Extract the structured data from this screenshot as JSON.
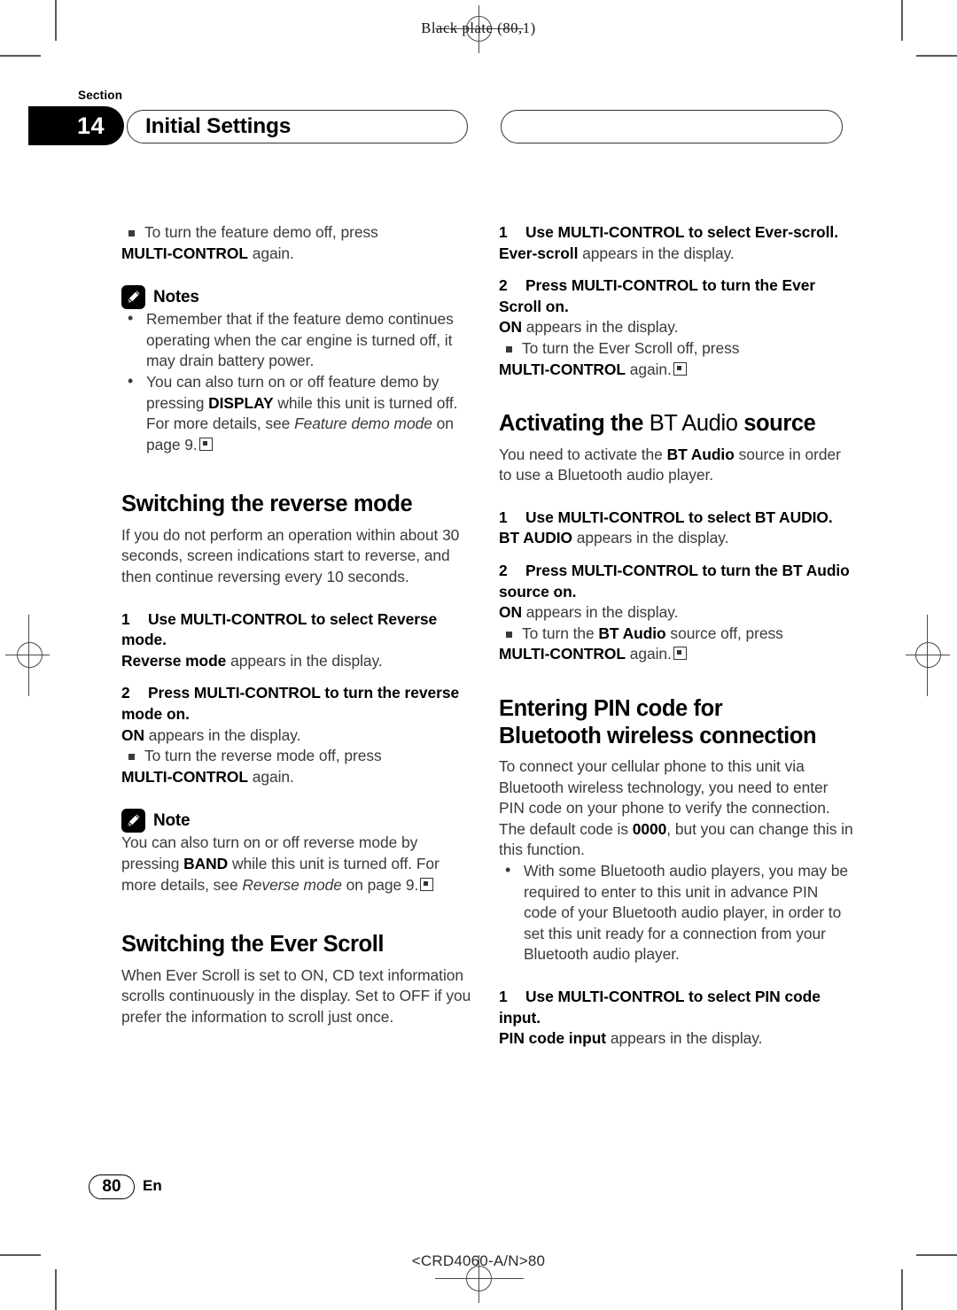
{
  "print_marks": {
    "plate_label": "Black plate (80,1)"
  },
  "header": {
    "section_word": "Section",
    "section_number": "14",
    "chapter_title": "Initial Settings"
  },
  "left_column": {
    "bullet_turn_demo_off": {
      "text_1": "To turn the feature demo off, press ",
      "bold_1": "MULTI-CONTROL",
      "text_2": " again."
    },
    "notes_label": "Notes",
    "note_items": [
      "Remember that if the feature demo continues operating when the car engine is turned off, it may drain battery power.",
      {
        "t1": "You can also turn on or off feature demo by pressing ",
        "b1": "DISPLAY",
        "t2": " while this unit is turned off. For more details, see ",
        "i1": "Feature demo mode",
        "t3": " on page 9."
      }
    ],
    "heading_reverse": "Switching the reverse mode",
    "intro_reverse": "If you do not perform an operation within about 30 seconds, screen indications start to reverse, and then continue reversing every 10 seconds.",
    "step1_num": "1",
    "step1_text": "Use MULTI-CONTROL to select Reverse mode.",
    "step1_result_bold": "Reverse mode",
    "step1_result_rest": " appears in the display.",
    "step2_num": "2",
    "step2_text": "Press MULTI-CONTROL to turn the reverse mode on.",
    "step2_result_bold": "ON",
    "step2_result_rest": " appears in the display.",
    "step2_bullet": {
      "text_1": "To turn the reverse mode off, press ",
      "bold_1": "MULTI-CONTROL",
      "text_2": " again."
    },
    "note_label": "Note",
    "note_body": {
      "t1": "You can also turn on or off reverse mode by pressing ",
      "b1": "BAND",
      "t2": " while this unit is turned off. For more details, see ",
      "i1": "Reverse mode",
      "t3": " on page 9."
    },
    "heading_ever_scroll": "Switching the Ever Scroll",
    "intro_ever_scroll": "When Ever Scroll is set to ON, CD text information scrolls continuously in the display. Set to OFF if you prefer the information to scroll just once."
  },
  "right_column": {
    "step1_num": "1",
    "step1_text": "Use MULTI-CONTROL to select Ever-scroll.",
    "step1_result_bold": "Ever-scroll",
    "step1_result_rest": " appears in the display.",
    "step2_num": "2",
    "step2_text": "Press MULTI-CONTROL to turn the Ever Scroll on.",
    "step2_result_bold": "ON",
    "step2_result_rest": " appears in the display.",
    "step2_bullet": {
      "text_1": "To turn the Ever Scroll off, press ",
      "bold_1": "MULTI-CONTROL",
      "text_2": " again."
    },
    "heading_bt_audio_a": "Activating the ",
    "heading_bt_audio_b": "BT Audio",
    "heading_bt_audio_c": " source",
    "intro_bt_audio": {
      "t1": "You need to activate the ",
      "b1": "BT Audio",
      "t2": " source in order to use a Bluetooth audio player."
    },
    "bt_step1_num": "1",
    "bt_step1_text": "Use MULTI-CONTROL to select BT AUDIO.",
    "bt_step1_result_bold": "BT AUDIO",
    "bt_step1_result_rest": " appears in the display.",
    "bt_step2_num": "2",
    "bt_step2_text": "Press MULTI-CONTROL to turn the BT Audio source on.",
    "bt_step2_result_bold": "ON",
    "bt_step2_result_rest": " appears in the display.",
    "bt_step2_bullet": {
      "text_1": "To turn the ",
      "bold_1": "BT Audio",
      "text_2": " source off, press ",
      "bold_2": "MULTI-CONTROL",
      "text_3": " again."
    },
    "heading_pin_line1": "Entering PIN code for",
    "heading_pin_line2": "Bluetooth wireless connection",
    "intro_pin": {
      "t1": "To connect your cellular phone to this unit via Bluetooth wireless technology, you need to enter PIN code on your phone to verify the connection. The default code is ",
      "b1": "0000",
      "t2": ", but you can change this in this function."
    },
    "pin_bullet": "With some Bluetooth audio players, you may be required to enter to this unit in advance PIN code of your Bluetooth audio player, in order to set this unit ready for a connection from your Bluetooth audio player.",
    "pin_step1_num": "1",
    "pin_step1_text": "Use MULTI-CONTROL to select PIN code input.",
    "pin_step1_result_bold": "PIN code input",
    "pin_step1_result_rest": " appears in the display."
  },
  "footer": {
    "page_number": "80",
    "language_code": "En",
    "document_code": "<CRD4060-A/N>80"
  }
}
